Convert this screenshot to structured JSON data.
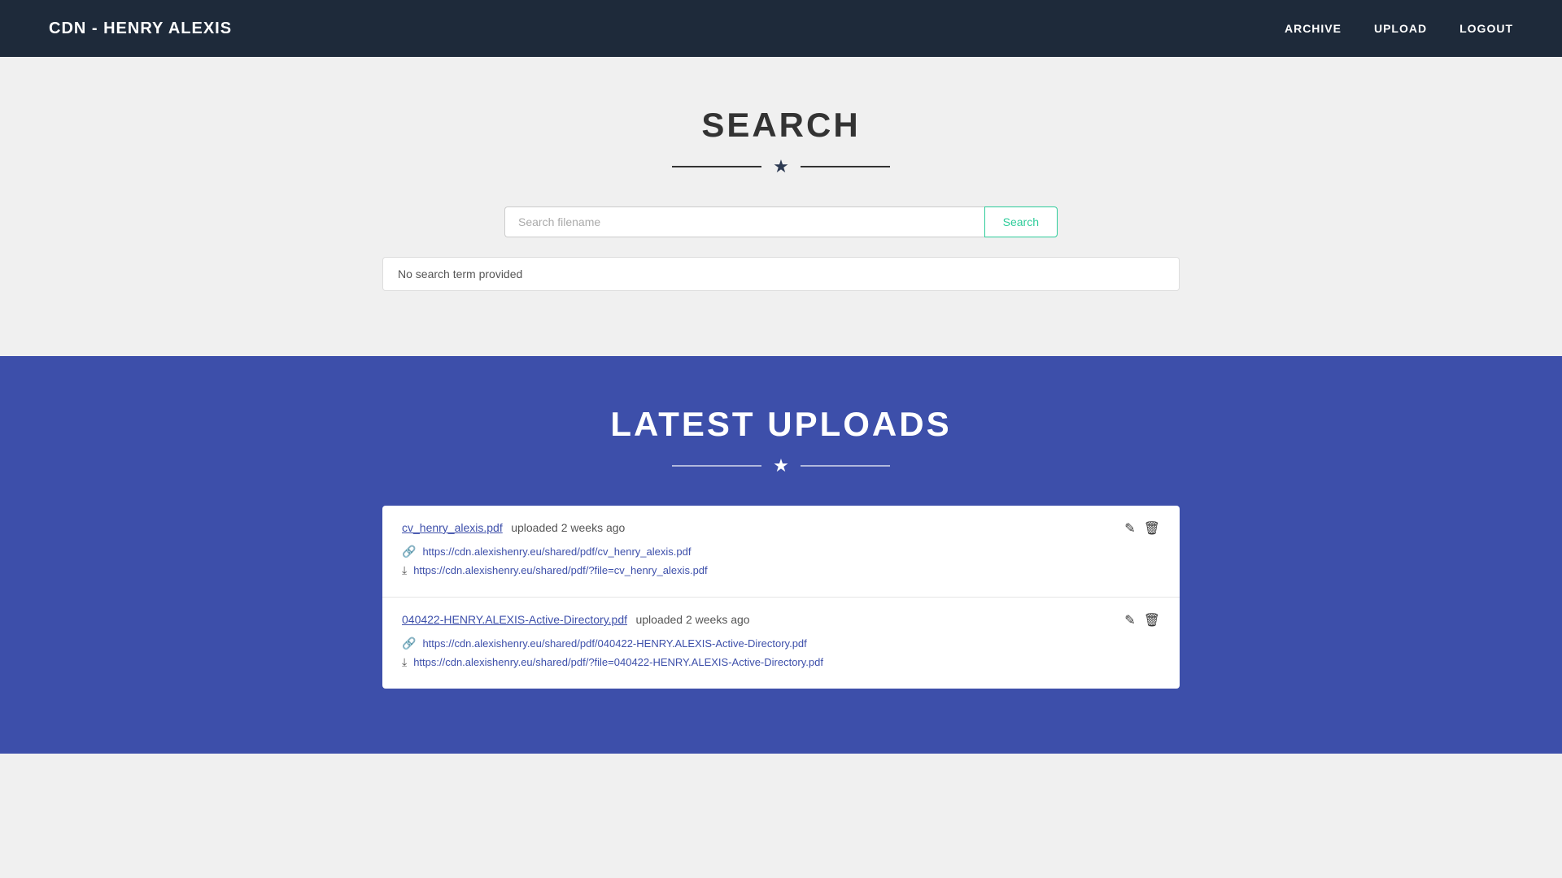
{
  "navbar": {
    "brand": "CDN - HENRY ALEXIS",
    "links": [
      {
        "label": "ARCHIVE",
        "name": "archive-link"
      },
      {
        "label": "UPLOAD",
        "name": "upload-link"
      },
      {
        "label": "LOGOUT",
        "name": "logout-link"
      }
    ]
  },
  "search_section": {
    "title": "SEARCH",
    "input_placeholder": "Search filename",
    "button_label": "Search",
    "alert_message": "No search term provided"
  },
  "uploads_section": {
    "title": "LATEST UPLOADS",
    "items": [
      {
        "filename": "cv_henry_alexis.pdf",
        "meta": "uploaded 2 weeks ago",
        "shared_url": "https://cdn.alexishenry.eu/shared/pdf/cv_henry_alexis.pdf",
        "download_url": "https://cdn.alexishenry.eu/shared/pdf/?file=cv_henry_alexis.pdf"
      },
      {
        "filename": "040422-HENRY.ALEXIS-Active-Directory.pdf",
        "meta": "uploaded 2 weeks ago",
        "shared_url": "https://cdn.alexishenry.eu/shared/pdf/040422-HENRY.ALEXIS-Active-Directory.pdf",
        "download_url": "https://cdn.alexishenry.eu/shared/pdf/?file=040422-HENRY.ALEXIS-Active-Directory.pdf"
      }
    ]
  }
}
